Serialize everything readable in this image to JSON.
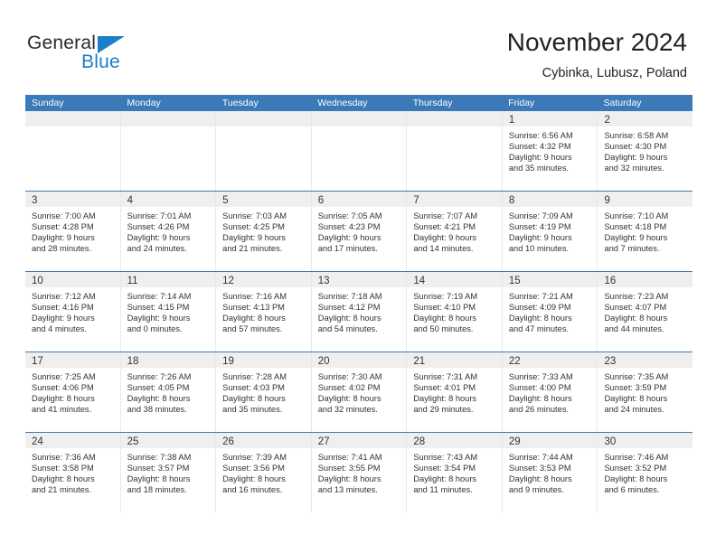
{
  "brand": {
    "name_top": "General",
    "name_bottom": "Blue",
    "accent_color": "#1a7ec8"
  },
  "header": {
    "title": "November 2024",
    "subtitle": "Cybinka, Lubusz, Poland"
  },
  "theme": {
    "header_blue": "#3b79b8",
    "day_band_gray": "#efefef",
    "text_color": "#333333"
  },
  "weekdays": [
    "Sunday",
    "Monday",
    "Tuesday",
    "Wednesday",
    "Thursday",
    "Friday",
    "Saturday"
  ],
  "labels": {
    "sunrise_prefix": "Sunrise:",
    "sunset_prefix": "Sunset:",
    "daylight_prefix": "Daylight:"
  },
  "weeks": [
    [
      {
        "empty": true
      },
      {
        "empty": true
      },
      {
        "empty": true
      },
      {
        "empty": true
      },
      {
        "empty": true
      },
      {
        "day": "1",
        "sunrise": "Sunrise: 6:56 AM",
        "sunset": "Sunset: 4:32 PM",
        "daylight_l1": "Daylight: 9 hours",
        "daylight_l2": "and 35 minutes."
      },
      {
        "day": "2",
        "sunrise": "Sunrise: 6:58 AM",
        "sunset": "Sunset: 4:30 PM",
        "daylight_l1": "Daylight: 9 hours",
        "daylight_l2": "and 32 minutes."
      }
    ],
    [
      {
        "day": "3",
        "sunrise": "Sunrise: 7:00 AM",
        "sunset": "Sunset: 4:28 PM",
        "daylight_l1": "Daylight: 9 hours",
        "daylight_l2": "and 28 minutes."
      },
      {
        "day": "4",
        "sunrise": "Sunrise: 7:01 AM",
        "sunset": "Sunset: 4:26 PM",
        "daylight_l1": "Daylight: 9 hours",
        "daylight_l2": "and 24 minutes."
      },
      {
        "day": "5",
        "sunrise": "Sunrise: 7:03 AM",
        "sunset": "Sunset: 4:25 PM",
        "daylight_l1": "Daylight: 9 hours",
        "daylight_l2": "and 21 minutes."
      },
      {
        "day": "6",
        "sunrise": "Sunrise: 7:05 AM",
        "sunset": "Sunset: 4:23 PM",
        "daylight_l1": "Daylight: 9 hours",
        "daylight_l2": "and 17 minutes."
      },
      {
        "day": "7",
        "sunrise": "Sunrise: 7:07 AM",
        "sunset": "Sunset: 4:21 PM",
        "daylight_l1": "Daylight: 9 hours",
        "daylight_l2": "and 14 minutes."
      },
      {
        "day": "8",
        "sunrise": "Sunrise: 7:09 AM",
        "sunset": "Sunset: 4:19 PM",
        "daylight_l1": "Daylight: 9 hours",
        "daylight_l2": "and 10 minutes."
      },
      {
        "day": "9",
        "sunrise": "Sunrise: 7:10 AM",
        "sunset": "Sunset: 4:18 PM",
        "daylight_l1": "Daylight: 9 hours",
        "daylight_l2": "and 7 minutes."
      }
    ],
    [
      {
        "day": "10",
        "sunrise": "Sunrise: 7:12 AM",
        "sunset": "Sunset: 4:16 PM",
        "daylight_l1": "Daylight: 9 hours",
        "daylight_l2": "and 4 minutes."
      },
      {
        "day": "11",
        "sunrise": "Sunrise: 7:14 AM",
        "sunset": "Sunset: 4:15 PM",
        "daylight_l1": "Daylight: 9 hours",
        "daylight_l2": "and 0 minutes."
      },
      {
        "day": "12",
        "sunrise": "Sunrise: 7:16 AM",
        "sunset": "Sunset: 4:13 PM",
        "daylight_l1": "Daylight: 8 hours",
        "daylight_l2": "and 57 minutes."
      },
      {
        "day": "13",
        "sunrise": "Sunrise: 7:18 AM",
        "sunset": "Sunset: 4:12 PM",
        "daylight_l1": "Daylight: 8 hours",
        "daylight_l2": "and 54 minutes."
      },
      {
        "day": "14",
        "sunrise": "Sunrise: 7:19 AM",
        "sunset": "Sunset: 4:10 PM",
        "daylight_l1": "Daylight: 8 hours",
        "daylight_l2": "and 50 minutes."
      },
      {
        "day": "15",
        "sunrise": "Sunrise: 7:21 AM",
        "sunset": "Sunset: 4:09 PM",
        "daylight_l1": "Daylight: 8 hours",
        "daylight_l2": "and 47 minutes."
      },
      {
        "day": "16",
        "sunrise": "Sunrise: 7:23 AM",
        "sunset": "Sunset: 4:07 PM",
        "daylight_l1": "Daylight: 8 hours",
        "daylight_l2": "and 44 minutes."
      }
    ],
    [
      {
        "day": "17",
        "sunrise": "Sunrise: 7:25 AM",
        "sunset": "Sunset: 4:06 PM",
        "daylight_l1": "Daylight: 8 hours",
        "daylight_l2": "and 41 minutes."
      },
      {
        "day": "18",
        "sunrise": "Sunrise: 7:26 AM",
        "sunset": "Sunset: 4:05 PM",
        "daylight_l1": "Daylight: 8 hours",
        "daylight_l2": "and 38 minutes."
      },
      {
        "day": "19",
        "sunrise": "Sunrise: 7:28 AM",
        "sunset": "Sunset: 4:03 PM",
        "daylight_l1": "Daylight: 8 hours",
        "daylight_l2": "and 35 minutes."
      },
      {
        "day": "20",
        "sunrise": "Sunrise: 7:30 AM",
        "sunset": "Sunset: 4:02 PM",
        "daylight_l1": "Daylight: 8 hours",
        "daylight_l2": "and 32 minutes."
      },
      {
        "day": "21",
        "sunrise": "Sunrise: 7:31 AM",
        "sunset": "Sunset: 4:01 PM",
        "daylight_l1": "Daylight: 8 hours",
        "daylight_l2": "and 29 minutes."
      },
      {
        "day": "22",
        "sunrise": "Sunrise: 7:33 AM",
        "sunset": "Sunset: 4:00 PM",
        "daylight_l1": "Daylight: 8 hours",
        "daylight_l2": "and 26 minutes."
      },
      {
        "day": "23",
        "sunrise": "Sunrise: 7:35 AM",
        "sunset": "Sunset: 3:59 PM",
        "daylight_l1": "Daylight: 8 hours",
        "daylight_l2": "and 24 minutes."
      }
    ],
    [
      {
        "day": "24",
        "sunrise": "Sunrise: 7:36 AM",
        "sunset": "Sunset: 3:58 PM",
        "daylight_l1": "Daylight: 8 hours",
        "daylight_l2": "and 21 minutes."
      },
      {
        "day": "25",
        "sunrise": "Sunrise: 7:38 AM",
        "sunset": "Sunset: 3:57 PM",
        "daylight_l1": "Daylight: 8 hours",
        "daylight_l2": "and 18 minutes."
      },
      {
        "day": "26",
        "sunrise": "Sunrise: 7:39 AM",
        "sunset": "Sunset: 3:56 PM",
        "daylight_l1": "Daylight: 8 hours",
        "daylight_l2": "and 16 minutes."
      },
      {
        "day": "27",
        "sunrise": "Sunrise: 7:41 AM",
        "sunset": "Sunset: 3:55 PM",
        "daylight_l1": "Daylight: 8 hours",
        "daylight_l2": "and 13 minutes."
      },
      {
        "day": "28",
        "sunrise": "Sunrise: 7:43 AM",
        "sunset": "Sunset: 3:54 PM",
        "daylight_l1": "Daylight: 8 hours",
        "daylight_l2": "and 11 minutes."
      },
      {
        "day": "29",
        "sunrise": "Sunrise: 7:44 AM",
        "sunset": "Sunset: 3:53 PM",
        "daylight_l1": "Daylight: 8 hours",
        "daylight_l2": "and 9 minutes."
      },
      {
        "day": "30",
        "sunrise": "Sunrise: 7:46 AM",
        "sunset": "Sunset: 3:52 PM",
        "daylight_l1": "Daylight: 8 hours",
        "daylight_l2": "and 6 minutes."
      }
    ]
  ]
}
